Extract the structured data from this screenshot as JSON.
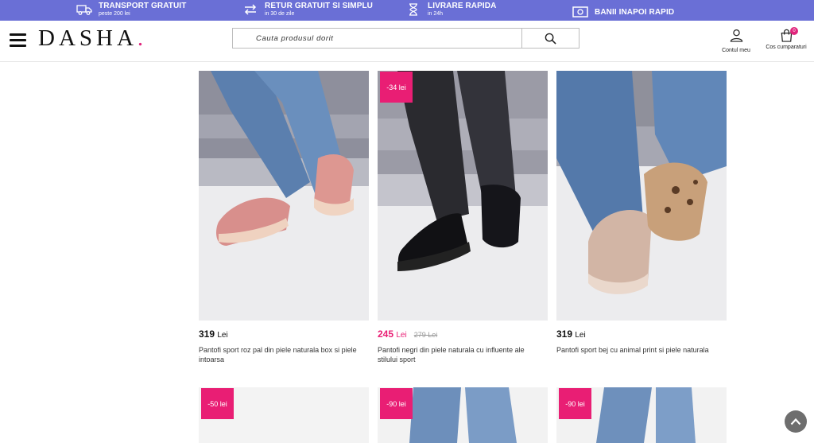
{
  "topbar": {
    "perks": [
      {
        "title": "TRANSPORT GRATUIT",
        "subtitle": "peste 200 lei",
        "icon": "truck-icon"
      },
      {
        "title": "RETUR GRATUIT SI SIMPLU",
        "subtitle": "in 30 de zile",
        "icon": "swap-arrows-icon"
      },
      {
        "title": "LIVRARE RAPIDA",
        "subtitle": "in 24h",
        "icon": "hourglass-icon"
      },
      {
        "title": "BANII INAPOI RAPID",
        "subtitle": "",
        "icon": "banknote-icon"
      }
    ]
  },
  "header": {
    "logo": "DASHA",
    "logo_dot": ".",
    "search_placeholder": "Cauta produsul dorit",
    "account_label": "Contul meu",
    "cart_label": "Cos cumparaturi",
    "cart_count": "0"
  },
  "products": [
    {
      "price": "319",
      "currency": "Lei",
      "old_price": "",
      "discount": "",
      "name": "Pantofi sport roz pal din piele naturala box si piele intoarsa"
    },
    {
      "price": "245",
      "currency": "Lei",
      "old_price": "279 Lei",
      "discount": "-34 lei",
      "name": "Pantofi negri din piele naturala cu influente ale stilului sport"
    },
    {
      "price": "319",
      "currency": "Lei",
      "old_price": "",
      "discount": "",
      "name": "Pantofi sport bej cu animal print si piele naturala"
    }
  ],
  "next_row": [
    {
      "discount": "-50 lei"
    },
    {
      "discount": "-90 lei"
    },
    {
      "discount": "-90 lei"
    }
  ],
  "colors": {
    "topbar": "#6a6fd6",
    "accent": "#e91e74",
    "logo_dot": "#e0257c"
  }
}
